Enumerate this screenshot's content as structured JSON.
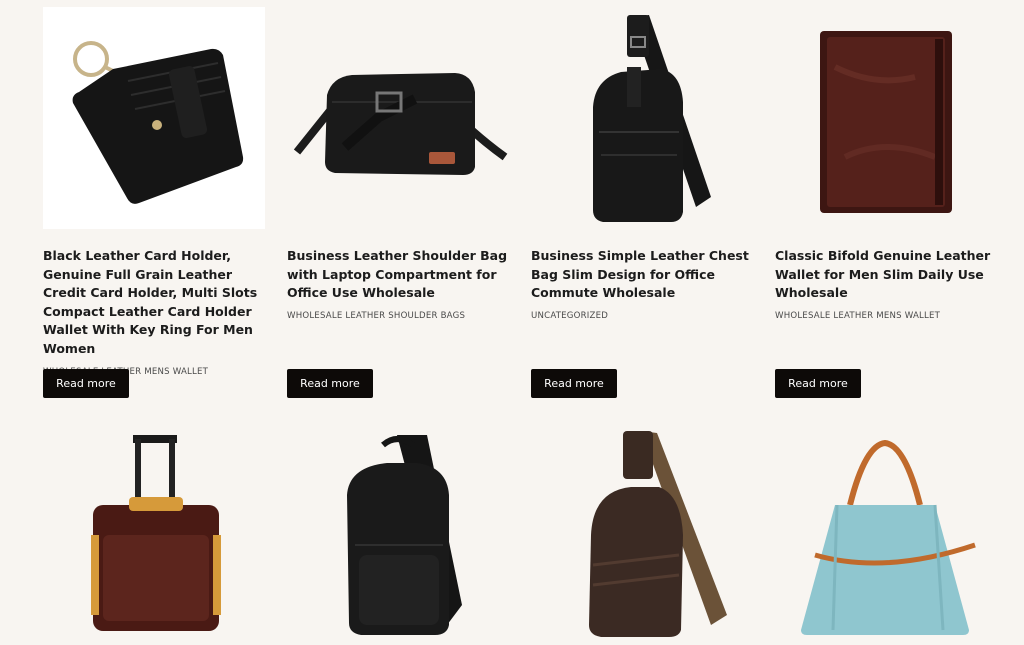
{
  "products": [
    {
      "title": "Black Leather Card Holder, Genuine Full Grain Leather Credit Card Holder, Multi Slots Compact Leather Card Holder Wallet With Key Ring For Men Women",
      "category": "WHOLESALE LEATHER MENS WALLET",
      "button": "Read more"
    },
    {
      "title": "Business Leather Shoulder Bag with Laptop Compartment for Office Use Wholesale",
      "category": "WHOLESALE LEATHER SHOULDER BAGS",
      "button": "Read more"
    },
    {
      "title": "Business Simple Leather Chest Bag Slim Design for Office Commute Wholesale",
      "category": "UNCATEGORIZED",
      "button": "Read more"
    },
    {
      "title": "Classic Bifold Genuine Leather Wallet for Men Slim Daily Use Wholesale",
      "category": "WHOLESALE LEATHER MENS WALLET",
      "button": "Read more"
    }
  ],
  "colors": {
    "page_bg": "#f8f5f1",
    "button_bg": "#0d0a08",
    "button_text": "#ffffff"
  }
}
